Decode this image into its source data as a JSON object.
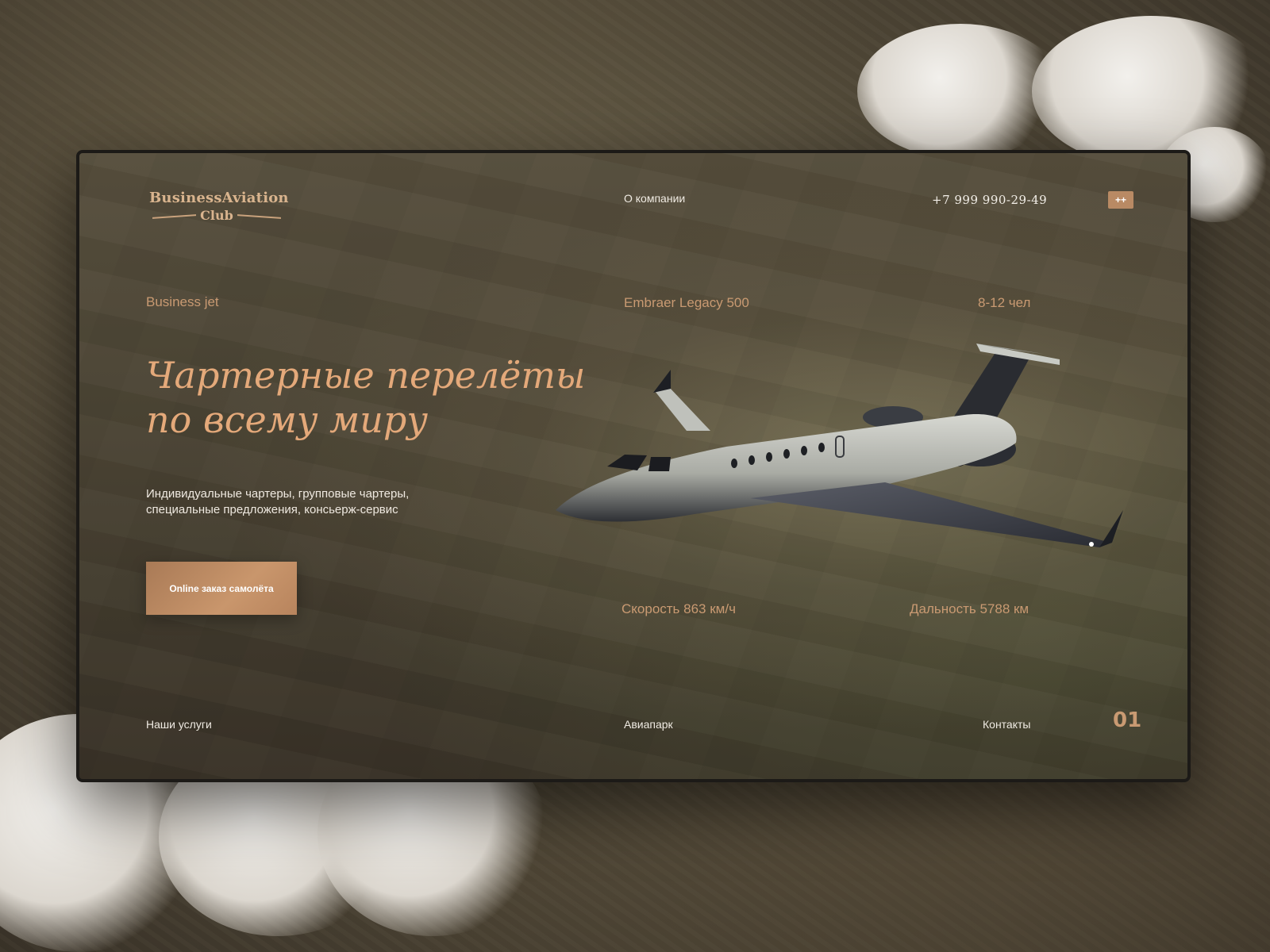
{
  "header": {
    "logo_top": "BusinessAviation",
    "logo_bottom": "Club",
    "nav_about": "О компании",
    "phone": "+7 999 990-29-49",
    "menu_button": "++"
  },
  "specs": {
    "category": "Business jet",
    "model": "Embraer Legacy 500",
    "capacity": "8-12 чел",
    "speed": "Скорость 863 км/ч",
    "range": "Дальность 5788 км"
  },
  "hero": {
    "title_line1": "Чартерные перелёты",
    "title_line2": "по всему миру",
    "subtitle_line1": "Индивидуальные чартеры, групповые чартеры,",
    "subtitle_line2": "специальные предложения, консьерж-сервис",
    "cta_label": "Online заказ самолёта"
  },
  "footer": {
    "services": "Наши услуги",
    "fleet": "Авиапарк",
    "contacts": "Контакты",
    "page_number": "01"
  },
  "colors": {
    "accent": "#c99a72",
    "title": "#e4a97a",
    "button": "#b98a64"
  }
}
